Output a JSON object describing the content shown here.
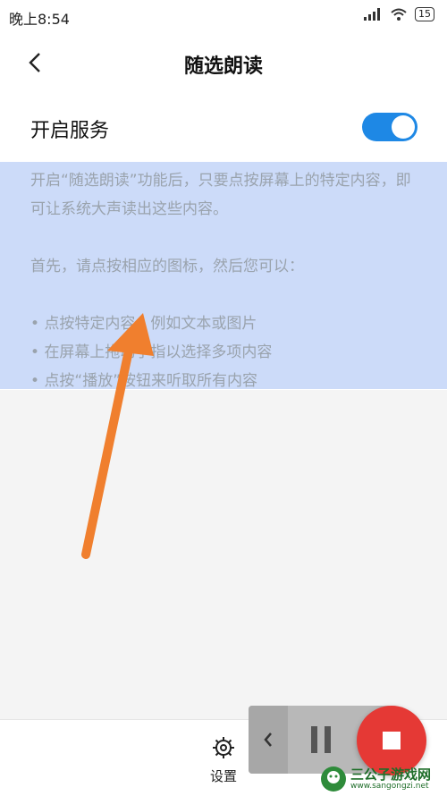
{
  "status_bar": {
    "time": "晚上8:54",
    "battery": "15"
  },
  "header": {
    "title": "随选朗读"
  },
  "service": {
    "label": "开启服务",
    "enabled": true,
    "accent": "#1e88e5"
  },
  "description": {
    "intro": "开启“随选朗读”功能后，只要点按屏幕上的特定内容，即可让系统大声读出这些内容。",
    "first": "首先，请点按相应的图标，然后您可以：",
    "bullets": [
      "点按特定内容，例如文本或图片",
      "在屏幕上拖动手指以选择多项内容",
      "点按“播放”按钮来听取所有内容"
    ]
  },
  "bottom": {
    "settings_label": "设置"
  },
  "colors": {
    "arrow": "#f07f2e",
    "stop": "#e53935",
    "selection": "#9ab8f4"
  },
  "watermark": {
    "name": "三公子游戏网",
    "url": "www.sangongzi.net"
  }
}
